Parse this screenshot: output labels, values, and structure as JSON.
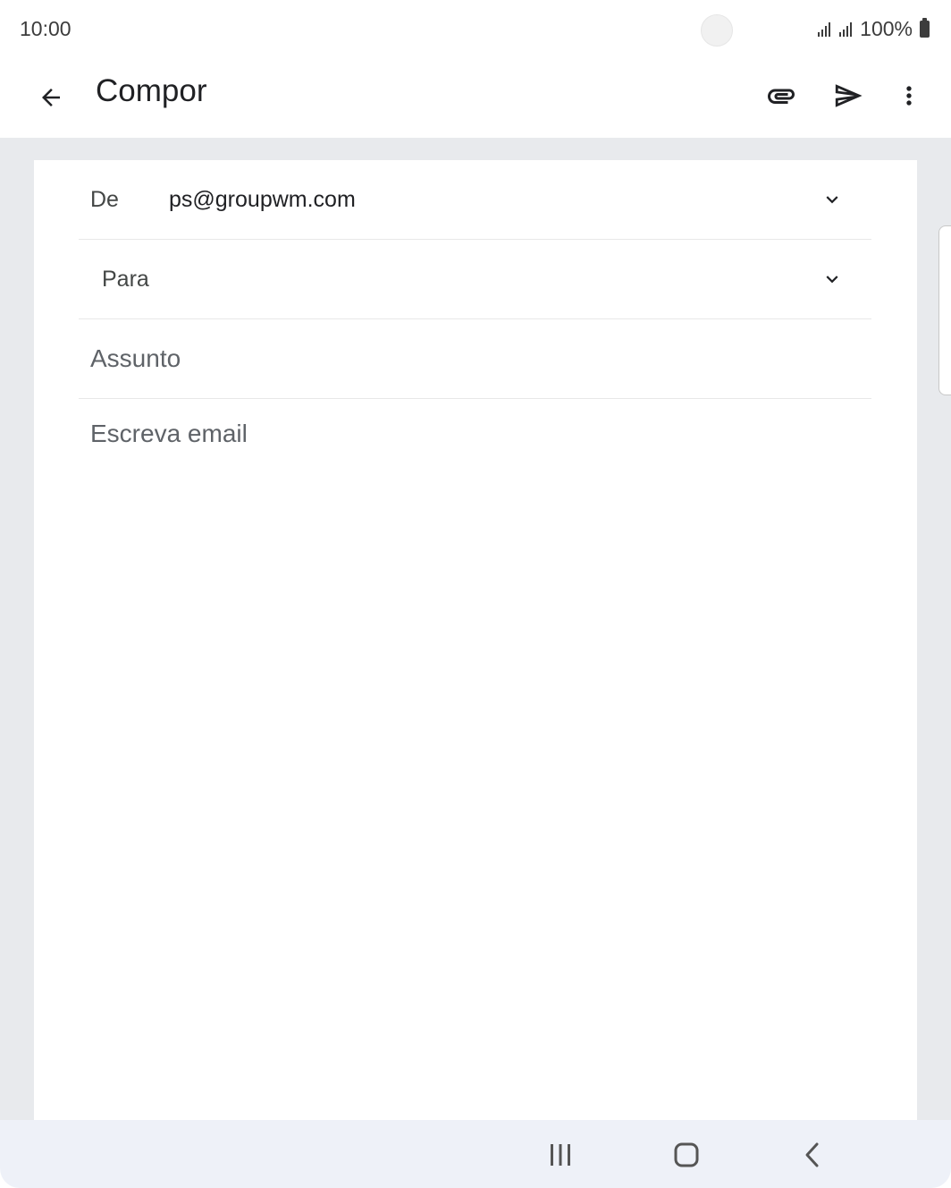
{
  "status_bar": {
    "time": "10:00",
    "battery": "100%"
  },
  "app_bar": {
    "title": "Compor",
    "icons": {
      "back": "back-arrow-icon",
      "attach": "paperclip-icon",
      "send": "send-icon",
      "more": "more-vert-icon"
    }
  },
  "compose": {
    "from_label": "De",
    "from_value": "ps@groupwm.com",
    "to_label": "Para",
    "to_value": "",
    "subject_placeholder": "Assunto",
    "subject_value": "",
    "body_placeholder": "Escreva email",
    "body_value": ""
  },
  "nav_bar": {
    "icons": [
      "recents-icon",
      "home-icon",
      "back-icon"
    ]
  },
  "colors": {
    "background": "#e8eaed",
    "card": "#ffffff",
    "nav_bar": "#eef1f8",
    "text_secondary": "#5f6368"
  }
}
